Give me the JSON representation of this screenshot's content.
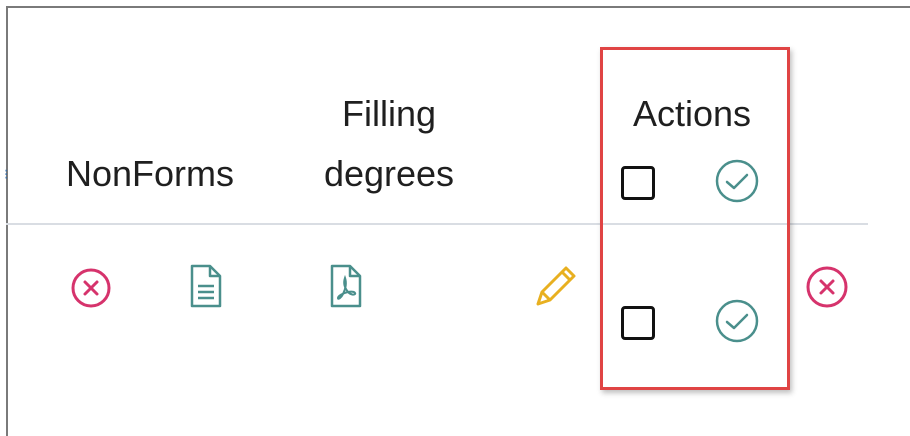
{
  "table": {
    "headers": {
      "nonforms": "NonForms",
      "filling_degrees_line1": "Filling",
      "filling_degrees_line2": "degrees",
      "actions": "Actions"
    },
    "row": {
      "status_icon": "close-circle-icon",
      "document_icon": "document-icon",
      "pdf_icon": "pdf-icon",
      "edit_icon": "pencil-icon",
      "action_checkbox_checked": false,
      "action_approve_icon": "check-circle-icon",
      "remove_icon": "close-circle-icon"
    },
    "header_action_checkbox_checked": false,
    "header_action_approve_icon": "check-circle-icon"
  },
  "colors": {
    "danger": "#d6336c",
    "teal": "#4a8f8c",
    "edit": "#e8b020",
    "highlight": "#e04444",
    "text": "#1f1f1f"
  }
}
